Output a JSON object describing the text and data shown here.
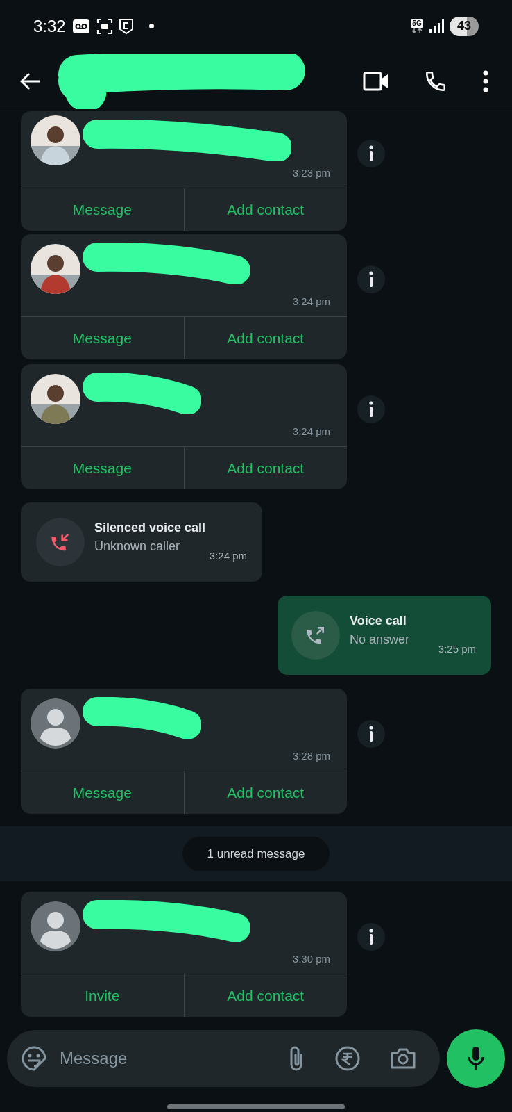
{
  "status_bar": {
    "time": "3:32",
    "network": "5G",
    "battery": "43"
  },
  "messages": [
    {
      "kind": "contact_card",
      "time": "3:23 pm",
      "actions": [
        "Message",
        "Add contact"
      ]
    },
    {
      "kind": "contact_card",
      "time": "3:24 pm",
      "actions": [
        "Message",
        "Add contact"
      ]
    },
    {
      "kind": "contact_card",
      "time": "3:24 pm",
      "actions": [
        "Message",
        "Add contact"
      ]
    },
    {
      "kind": "incoming_call",
      "missed": true,
      "title": "Silenced voice call",
      "subtitle": "Unknown caller",
      "time": "3:24 pm"
    },
    {
      "kind": "outgoing_call",
      "missed": false,
      "title": "Voice call",
      "subtitle": "No answer",
      "time": "3:25 pm"
    },
    {
      "kind": "contact_card",
      "avatar": {
        "kind": "default"
      },
      "time": "3:28 pm",
      "actions": [
        "Message",
        "Add contact"
      ]
    },
    {
      "kind": "unread_divider",
      "label": "1 unread message"
    },
    {
      "kind": "contact_card",
      "avatar": {
        "kind": "default"
      },
      "time": "3:30 pm",
      "actions": [
        "Invite",
        "Add contact"
      ]
    }
  ],
  "composer": {
    "placeholder": "Message"
  }
}
